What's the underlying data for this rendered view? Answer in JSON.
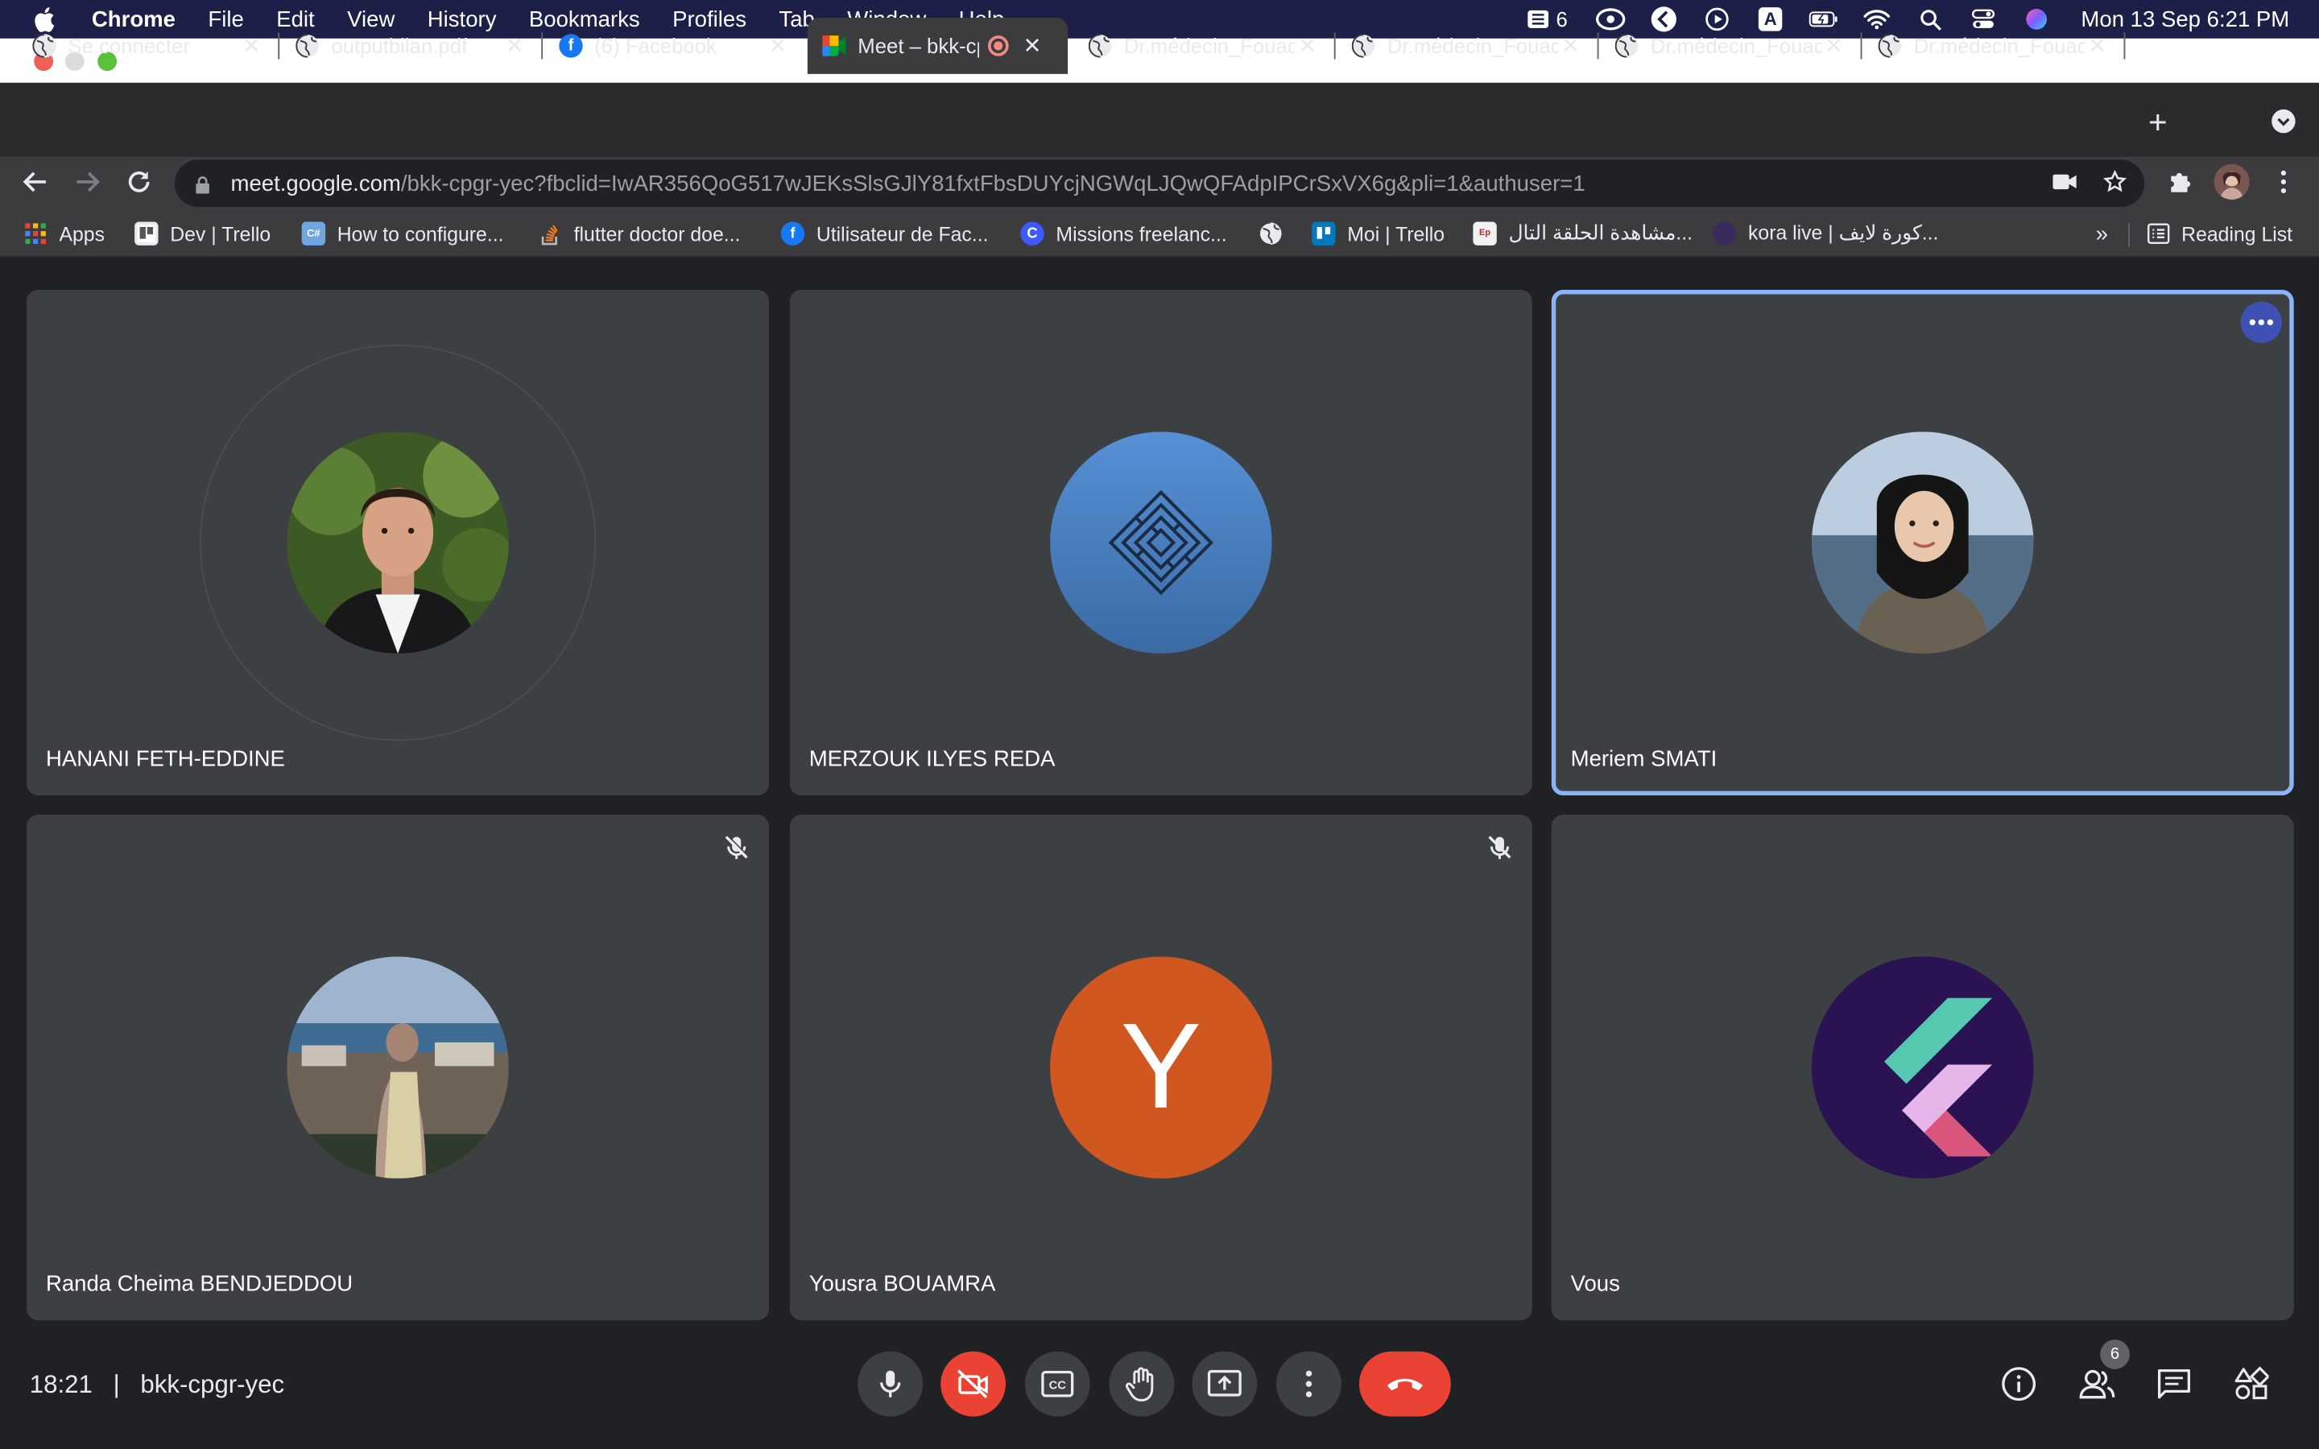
{
  "menubar": {
    "app": "Chrome",
    "items": [
      "File",
      "Edit",
      "View",
      "History",
      "Bookmarks",
      "Profiles",
      "Tab",
      "Window",
      "Help"
    ],
    "status_count": "6",
    "input_source": "A",
    "clock": "Mon 13 Sep  6:21 PM"
  },
  "tabs": [
    {
      "title": "Se connecter",
      "icon": "globe-icon"
    },
    {
      "title": "outputbilan.pdf",
      "icon": "globe-icon"
    },
    {
      "title": "(6) Facebook",
      "icon": "facebook-icon"
    },
    {
      "title": "Meet – bkk-cpgr-yec",
      "icon": "meet-icon",
      "active": true
    },
    {
      "title": "Dr.médecin_Fouad",
      "icon": "globe-icon"
    },
    {
      "title": "Dr.médecin_Fouad",
      "icon": "globe-icon"
    },
    {
      "title": "Dr.médecin_Fouad",
      "icon": "globe-icon"
    },
    {
      "title": "Dr.médecin_Fouad",
      "icon": "globe-icon"
    }
  ],
  "omnibox": {
    "host": "meet.google.com",
    "path": "/bkk-cpgr-yec?fbclid=IwAR356QoG517wJEKsSlsGJlY81fxtFbsDUYcjNGWqLJQwQFAdpIPCrSxVX6g&pli=1&authuser=1"
  },
  "bookmarks": [
    {
      "label": "Apps",
      "icon": "apps-grid-icon"
    },
    {
      "label": "Dev | Trello",
      "icon": "trello-icon"
    },
    {
      "label": "How to configure...",
      "icon": "page-icon"
    },
    {
      "label": "flutter doctor doe...",
      "icon": "stackoverflow-icon"
    },
    {
      "label": "Utilisateur de Fac...",
      "icon": "facebook-icon"
    },
    {
      "label": "Missions freelanc...",
      "icon": "codeur-icon"
    },
    {
      "label": "",
      "icon": "globe-icon"
    },
    {
      "label": "Moi | Trello",
      "icon": "trello-icon"
    },
    {
      "label": "مشاهدة الحلقة التال...",
      "icon": "site-icon"
    },
    {
      "label": "kora live | كورة لايف...",
      "icon": "kora-icon"
    }
  ],
  "bookmarks_overflow": "»",
  "reading_list": "Reading List",
  "participants": [
    {
      "name": "HANANI FETH-EDDINE",
      "muted": false,
      "speaking": false
    },
    {
      "name": "MERZOUK ILYES REDA",
      "muted": false,
      "speaking": false
    },
    {
      "name": "Meriem SMATI",
      "muted": false,
      "speaking": true
    },
    {
      "name": "Randa Cheima BENDJEDDOU",
      "muted": true,
      "speaking": false
    },
    {
      "name": "Yousra BOUAMRA",
      "muted": true,
      "speaking": false,
      "initial": "Y"
    },
    {
      "name": "Vous",
      "muted": false,
      "speaking": false
    }
  ],
  "meeting": {
    "time": "18:21",
    "separator": "|",
    "code": "bkk-cpgr-yec",
    "participant_count": "6"
  },
  "colors": {
    "hangup": "#ea4335",
    "speaking_border": "#8ab4f8",
    "yousra_avatar": "#d0571f",
    "tile_bg": "#3c4043"
  }
}
